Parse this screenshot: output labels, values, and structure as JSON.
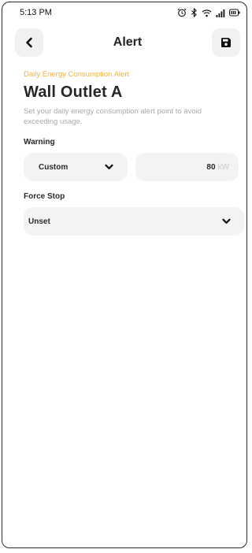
{
  "status": {
    "time": "5:13 PM"
  },
  "header": {
    "title": "Alert"
  },
  "alert": {
    "kicker": "Daily Energy Consumption Alert",
    "device": "Wall Outlet A",
    "description": "Set your daily energy consumption alert point to avoid exceeding usage."
  },
  "warning": {
    "label": "Warning",
    "mode": "Custom",
    "value": "80",
    "unit": "kW"
  },
  "force_stop": {
    "label": "Force Stop",
    "value": "Unset"
  },
  "colors": {
    "accent": "#f3b03b",
    "field_bg": "#f3f3f5",
    "text": "#262626",
    "muted": "#a9a9a9"
  }
}
